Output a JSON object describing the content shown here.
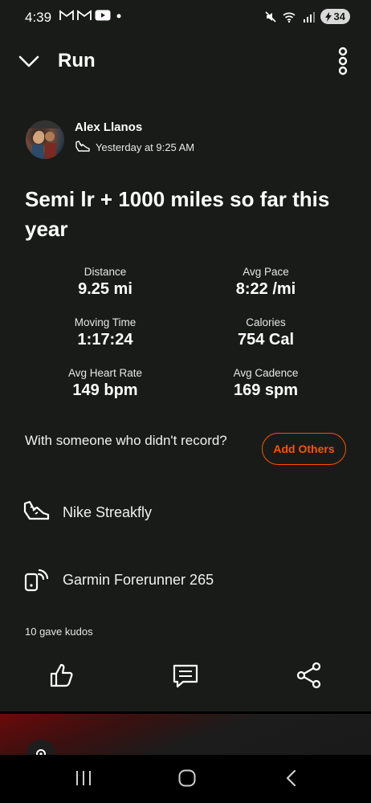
{
  "status_bar": {
    "time": "4:39",
    "notification_icons": [
      "gmail-icon",
      "gmail-icon",
      "youtube-icon",
      "dot-icon"
    ],
    "system_icons": [
      "mute-icon",
      "wifi-icon",
      "signal-icon"
    ],
    "battery": "34"
  },
  "header": {
    "title": "Run"
  },
  "athlete": {
    "name": "Alex Llanos",
    "timestamp": "Yesterday at 9:25 AM"
  },
  "activity": {
    "title": "Semi lr + 1000 miles so far this year"
  },
  "stats": [
    {
      "label": "Distance",
      "value": "9.25 mi"
    },
    {
      "label": "Avg Pace",
      "value": "8:22 /mi"
    },
    {
      "label": "Moving Time",
      "value": "1:17:24"
    },
    {
      "label": "Calories",
      "value": "754 Cal"
    },
    {
      "label": "Avg Heart Rate",
      "value": "149 bpm"
    },
    {
      "label": "Avg Cadence",
      "value": "169 spm"
    }
  ],
  "others": {
    "prompt": "With someone who didn't record?",
    "button_label": "Add Others"
  },
  "gear": {
    "shoes": "Nike Streakfly",
    "device": "Garmin Forerunner 265"
  },
  "kudos": {
    "text": "10 gave kudos"
  },
  "colors": {
    "background": "#191b19",
    "accent": "#fc5200",
    "text": "#ffffff"
  }
}
